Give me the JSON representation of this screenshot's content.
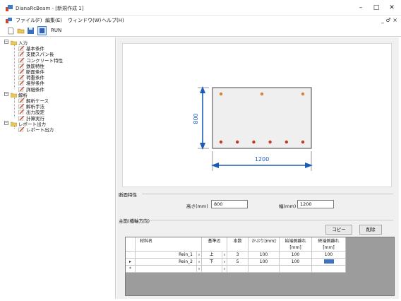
{
  "window": {
    "title": "DianaRcBeam - [新規作成 1]",
    "controls": {
      "minimize": "–",
      "maximize": "□",
      "close": "✕"
    }
  },
  "menu": {
    "items": [
      "ファイル(F)",
      "編集(E)",
      "ウィンドウ(W)",
      "ヘルプ(H)"
    ],
    "mdi_controls": "_ ♂ ×"
  },
  "toolbar": {
    "run_label": "RUN"
  },
  "tree": {
    "groups": [
      {
        "label": "入力",
        "items": [
          "基本条件",
          "支間スパン長",
          "コンクリート特性",
          "鉄筋特性",
          "断面条件",
          "荷重条件",
          "境界条件",
          "詳細条件"
        ]
      },
      {
        "label": "解析",
        "items": [
          "解析ケース",
          "解析手法",
          "出力設定",
          "計算実行"
        ]
      },
      {
        "label": "レポート出力",
        "items": [
          "レポート出力"
        ]
      }
    ]
  },
  "drawing": {
    "height_dim": "800",
    "width_dim": "1200",
    "top_bar_count": 3,
    "bottom_bar_count": 6,
    "colors": {
      "section_fill": "#efefef",
      "top_bar": "#d4872a",
      "bottom_bar": "#c8361d",
      "dim_line": "#1b5bb5"
    }
  },
  "section_props": {
    "label": "断面特性",
    "height_label": "高さ(mm)",
    "height_value": "800",
    "width_label": "幅(mm)",
    "width_value": "1200"
  },
  "main_rebar": {
    "label": "主筋(橋軸方向)",
    "copy_button": "コピー",
    "delete_button": "削除",
    "columns": [
      "材料名",
      "基準辺",
      "本数",
      "かぶり[mm]",
      "始端側離れ [mm]",
      "終端側離れ [mm]"
    ],
    "rows": [
      {
        "marker": "",
        "material": "Rein_1",
        "edge": "上",
        "count": "3",
        "cover": "100",
        "start_offset": "100",
        "end_offset": "100"
      },
      {
        "marker": "▸",
        "material": "Rein_2",
        "edge": "下",
        "count": "5",
        "cover": "100",
        "start_offset": "100",
        "end_offset": ""
      }
    ],
    "new_row_marker": "*"
  }
}
